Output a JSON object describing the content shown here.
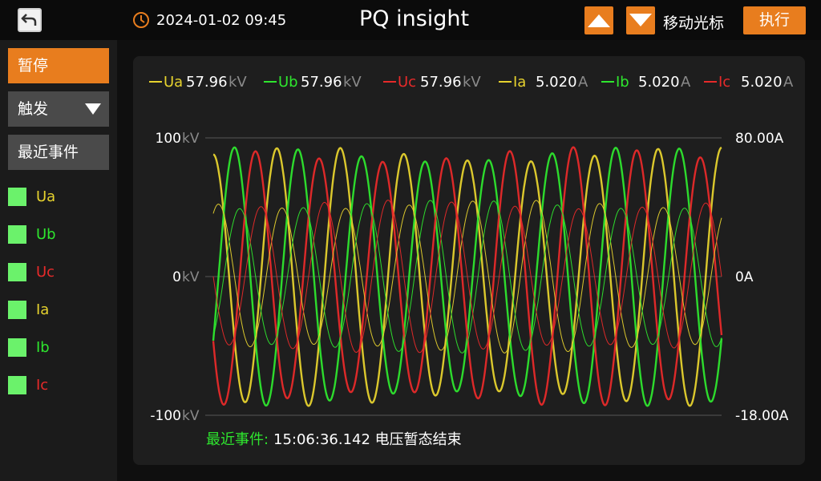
{
  "header": {
    "datetime": "2024-01-02 09:45",
    "title": "PQ insight",
    "move_cursor_label": "移动光标",
    "execute_label": "执行"
  },
  "sidebar": {
    "pause_label": "暂停",
    "trigger_label": "触发",
    "recent_events_label": "最近事件",
    "channels": [
      {
        "label": "Ua",
        "color": "#e6d22e",
        "checked": true
      },
      {
        "label": "Ub",
        "color": "#2ee62e",
        "checked": true
      },
      {
        "label": "Uc",
        "color": "#e82a2a",
        "checked": true
      },
      {
        "label": "Ia",
        "color": "#e6d22e",
        "checked": true
      },
      {
        "label": "Ib",
        "color": "#2ee62e",
        "checked": true
      },
      {
        "label": "Ic",
        "color": "#e82a2a",
        "checked": true
      }
    ]
  },
  "readouts": [
    {
      "name": "Ua",
      "value": "57.96",
      "unit": "kV",
      "color": "#e6d22e"
    },
    {
      "name": "Ub",
      "value": "57.96",
      "unit": "kV",
      "color": "#2ee62e"
    },
    {
      "name": "Uc",
      "value": "57.96",
      "unit": "kV",
      "color": "#e82a2a"
    },
    {
      "name": "Ia",
      "value": "5.020",
      "unit": "A",
      "color": "#e6d22e"
    },
    {
      "name": "Ib",
      "value": "5.020",
      "unit": "A",
      "color": "#2ee62e"
    },
    {
      "name": "Ic",
      "value": "5.020",
      "unit": "A",
      "color": "#e82a2a"
    }
  ],
  "chart_data": {
    "type": "line",
    "grid": true,
    "left_axis": {
      "unit": "kV",
      "ylim": [
        -100,
        100
      ],
      "ticks": [
        "100",
        "0",
        "-100"
      ]
    },
    "right_axis": {
      "ylim": [
        -18,
        80
      ],
      "ticks": [
        "80.00A",
        "0A",
        "-18.00A"
      ]
    },
    "x": {
      "cycles": 8
    },
    "series": [
      {
        "name": "Ua",
        "axis": "left",
        "color": "#e6d22e",
        "amplitude": 88,
        "phase_deg": 0
      },
      {
        "name": "Ub",
        "axis": "left",
        "color": "#2ee62e",
        "amplitude": 88,
        "phase_deg": -120
      },
      {
        "name": "Uc",
        "axis": "left",
        "color": "#e82a2a",
        "amplitude": 88,
        "phase_deg": 120
      },
      {
        "name": "Ia",
        "axis": "right",
        "color": "#e6d22e",
        "amplitude": 52,
        "phase_deg": -30
      },
      {
        "name": "Ib",
        "axis": "right",
        "color": "#2ee62e",
        "amplitude": 52,
        "phase_deg": -150
      },
      {
        "name": "Ic",
        "axis": "right",
        "color": "#e82a2a",
        "amplitude": 52,
        "phase_deg": 90
      }
    ]
  },
  "recent_event": {
    "label": "最近事件:",
    "text": "15:06:36.142 电压暂态结束"
  },
  "icons": {
    "back": "back-arrow-icon",
    "clock": "clock-icon",
    "up": "triangle-up-icon",
    "down": "triangle-down-icon"
  }
}
